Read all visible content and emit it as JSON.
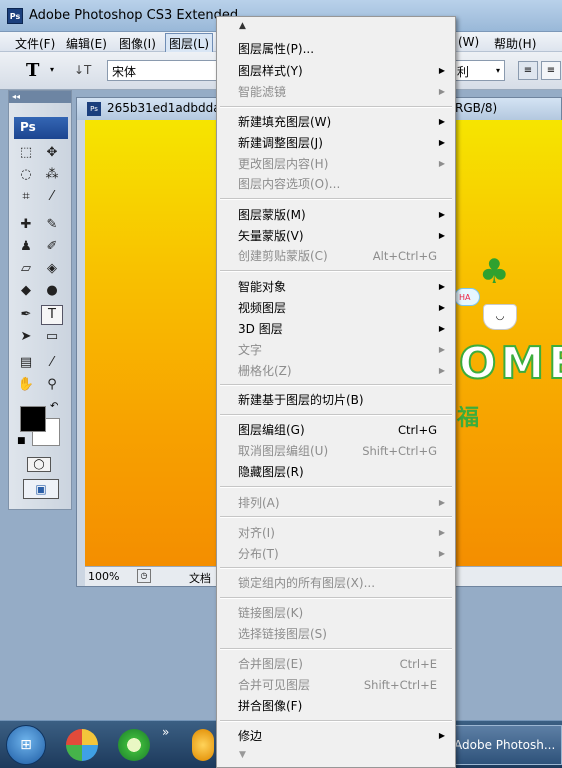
{
  "window": {
    "title": "Adobe Photoshop CS3 Extended",
    "app_icon": "Ps"
  },
  "menubar": {
    "items": [
      "文件(F)",
      "编辑(E)",
      "图像(I)",
      "图层(L)",
      "(W)",
      "帮助(H)"
    ]
  },
  "options_bar": {
    "tool_glyph": "T",
    "font_family_value": "宋体",
    "antialias_value": "利"
  },
  "toolbox": {
    "logo": "Ps"
  },
  "document": {
    "tab_title": "265b31ed1adbdda",
    "mode_suffix": "RGB/8)",
    "zoom": "100%",
    "doc_label": "文档",
    "art_text": "OME",
    "art_text2": "福",
    "bubble_text": "HA"
  },
  "layer_menu": {
    "items": [
      {
        "label": "图层属性(P)...",
        "shortcut": "",
        "submenu": false,
        "disabled": false
      },
      {
        "label": "图层样式(Y)",
        "shortcut": "",
        "submenu": true,
        "disabled": false
      },
      {
        "label": "智能滤镜",
        "shortcut": "",
        "submenu": true,
        "disabled": true
      },
      {
        "label": "新建填充图层(W)",
        "shortcut": "",
        "submenu": true,
        "disabled": false
      },
      {
        "label": "新建调整图层(J)",
        "shortcut": "",
        "submenu": true,
        "disabled": false
      },
      {
        "label": "更改图层内容(H)",
        "shortcut": "",
        "submenu": true,
        "disabled": true
      },
      {
        "label": "图层内容选项(O)...",
        "shortcut": "",
        "submenu": false,
        "disabled": true
      },
      {
        "label": "图层蒙版(M)",
        "shortcut": "",
        "submenu": true,
        "disabled": false
      },
      {
        "label": "矢量蒙版(V)",
        "shortcut": "",
        "submenu": true,
        "disabled": false
      },
      {
        "label": "创建剪贴蒙版(C)",
        "shortcut": "Alt+Ctrl+G",
        "submenu": false,
        "disabled": true
      },
      {
        "label": "智能对象",
        "shortcut": "",
        "submenu": true,
        "disabled": false
      },
      {
        "label": "视频图层",
        "shortcut": "",
        "submenu": true,
        "disabled": false
      },
      {
        "label": "3D 图层",
        "shortcut": "",
        "submenu": true,
        "disabled": false
      },
      {
        "label": "文字",
        "shortcut": "",
        "submenu": true,
        "disabled": true
      },
      {
        "label": "栅格化(Z)",
        "shortcut": "",
        "submenu": true,
        "disabled": true
      },
      {
        "label": "新建基于图层的切片(B)",
        "shortcut": "",
        "submenu": false,
        "disabled": false
      },
      {
        "label": "图层编组(G)",
        "shortcut": "Ctrl+G",
        "submenu": false,
        "disabled": false
      },
      {
        "label": "取消图层编组(U)",
        "shortcut": "Shift+Ctrl+G",
        "submenu": false,
        "disabled": true
      },
      {
        "label": "隐藏图层(R)",
        "shortcut": "",
        "submenu": false,
        "disabled": false
      },
      {
        "label": "排列(A)",
        "shortcut": "",
        "submenu": true,
        "disabled": true
      },
      {
        "label": "对齐(I)",
        "shortcut": "",
        "submenu": true,
        "disabled": true
      },
      {
        "label": "分布(T)",
        "shortcut": "",
        "submenu": true,
        "disabled": true
      },
      {
        "label": "锁定组内的所有图层(X)...",
        "shortcut": "",
        "submenu": false,
        "disabled": true
      },
      {
        "label": "链接图层(K)",
        "shortcut": "",
        "submenu": false,
        "disabled": true
      },
      {
        "label": "选择链接图层(S)",
        "shortcut": "",
        "submenu": false,
        "disabled": true
      },
      {
        "label": "合并图层(E)",
        "shortcut": "Ctrl+E",
        "submenu": false,
        "disabled": true
      },
      {
        "label": "合并可见图层",
        "shortcut": "Shift+Ctrl+E",
        "submenu": false,
        "disabled": true
      },
      {
        "label": "拼合图像(F)",
        "shortcut": "",
        "submenu": false,
        "disabled": false
      },
      {
        "label": "修边",
        "shortcut": "",
        "submenu": true,
        "disabled": false
      }
    ]
  },
  "taskbar": {
    "ps_task_label": "Adobe Photosh...",
    "more_glyph": "»"
  },
  "colors": {
    "menu_bg": "#f0f0f0",
    "disabled_text": "#8d8d8d",
    "canvas_top": "#f6e500",
    "canvas_bottom": "#f48e00"
  }
}
